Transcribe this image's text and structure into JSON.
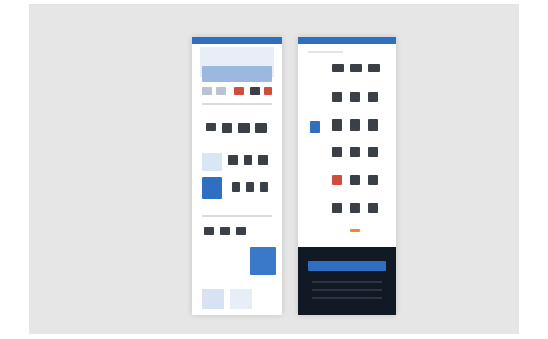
{
  "mockup": {
    "description": ""
  }
}
